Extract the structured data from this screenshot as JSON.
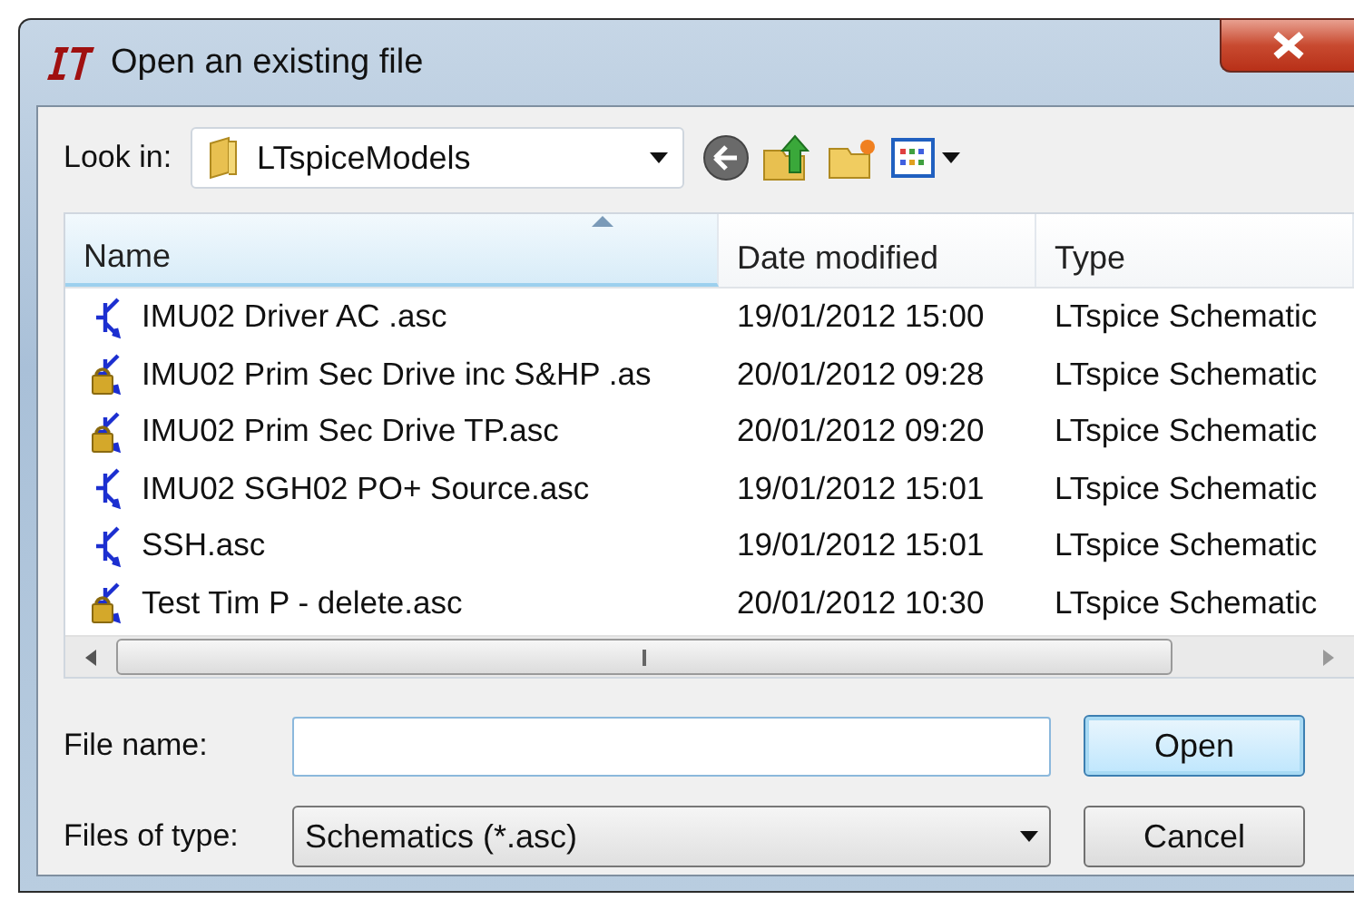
{
  "window": {
    "title": "Open an existing file"
  },
  "look_in": {
    "label": "Look in:",
    "value": "LTspiceModels"
  },
  "file_list": {
    "columns": [
      {
        "label": "Name",
        "sorted": true
      },
      {
        "label": "Date modified",
        "sorted": false
      },
      {
        "label": "Type",
        "sorted": false
      }
    ],
    "rows": [
      {
        "name": "IMU02 Driver AC .asc",
        "date": "19/01/2012 15:00",
        "type": "LTspice Schematic",
        "locked": false
      },
      {
        "name": "IMU02 Prim Sec Drive inc S&HP .as",
        "date": "20/01/2012 09:28",
        "type": "LTspice Schematic",
        "locked": true
      },
      {
        "name": "IMU02 Prim Sec Drive TP.asc",
        "date": "20/01/2012 09:20",
        "type": "LTspice Schematic",
        "locked": true
      },
      {
        "name": "IMU02 SGH02 PO+ Source.asc",
        "date": "19/01/2012 15:01",
        "type": "LTspice Schematic",
        "locked": false
      },
      {
        "name": "SSH.asc",
        "date": "19/01/2012 15:01",
        "type": "LTspice Schematic",
        "locked": false
      },
      {
        "name": "Test Tim P - delete.asc",
        "date": "20/01/2012 10:30",
        "type": "LTspice Schematic",
        "locked": true
      }
    ]
  },
  "file_name": {
    "label": "File name:"
  },
  "file_type": {
    "label": "Files of type:",
    "value": "Schematics (*.asc)"
  },
  "buttons": [
    {
      "label": "Open",
      "default": true
    },
    {
      "label": "Cancel",
      "default": false
    }
  ]
}
